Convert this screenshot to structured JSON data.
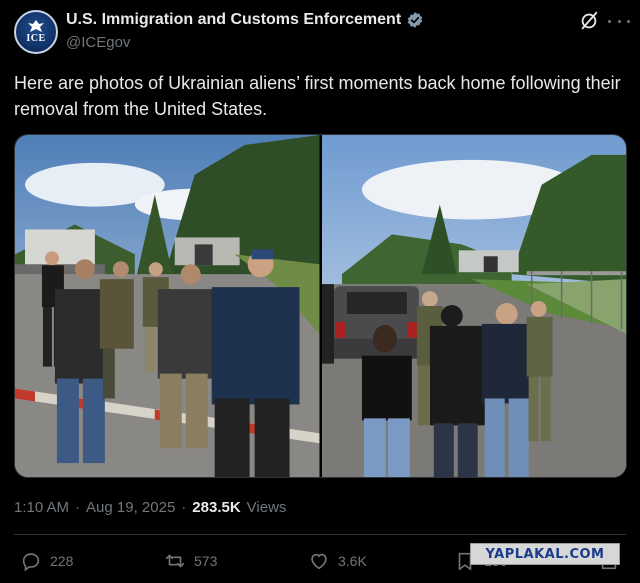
{
  "author": {
    "display_name": "U.S. Immigration and Customs Enforcement",
    "handle": "@ICEgov",
    "avatar_text": "ICE",
    "verified_color": "#829aab"
  },
  "tweet": {
    "text": "Here are photos of Ukrainian aliens’ first moments back home following their removal from the United States."
  },
  "media": {
    "photos": [
      {
        "alt_icon": "photo-left"
      },
      {
        "alt_icon": "photo-right"
      }
    ]
  },
  "meta": {
    "time": "1:10 AM",
    "separator": "·",
    "date": "Aug 19, 2025",
    "views_count": "283.5K",
    "views_label": "Views"
  },
  "actions": {
    "replies": "228",
    "reposts": "573",
    "likes": "3.6K",
    "bookmarks": "136"
  },
  "watermark": {
    "text": "YAPLAKAL.COM"
  },
  "colors": {
    "background": "#000000",
    "text_primary": "#e7e9ea",
    "text_secondary": "#71767b",
    "border": "#2f3336"
  }
}
